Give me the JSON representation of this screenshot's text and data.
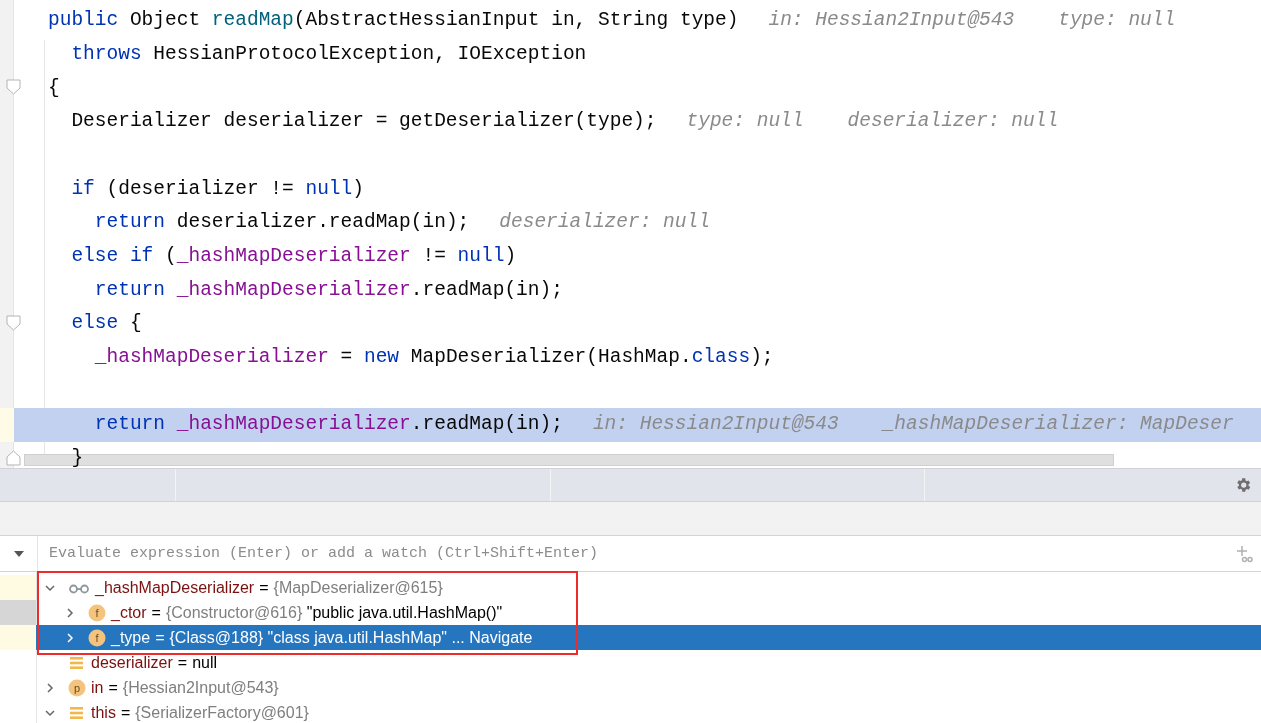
{
  "editor": {
    "lines": [
      {
        "kind": "code",
        "tokens": [
          {
            "text": "public",
            "kind": "keyword"
          },
          {
            "text": " Object ",
            "kind": "plain"
          },
          {
            "text": "readMap",
            "kind": "method"
          },
          {
            "text": "(AbstractHessianInput in, String type)",
            "kind": "plain"
          }
        ],
        "hints": [
          "in: Hessian2Input@543",
          "type: null"
        ],
        "selected": false
      },
      {
        "kind": "code",
        "tokens": [
          {
            "text": "  throws",
            "kind": "keyword"
          },
          {
            "text": " HessianProtocolException, IOException",
            "kind": "plain"
          }
        ],
        "selected": false
      },
      {
        "kind": "fold-start",
        "tokens": [
          {
            "text": "{",
            "kind": "plain"
          }
        ],
        "selected": false
      },
      {
        "kind": "code",
        "tokens": [
          {
            "text": "  Deserializer deserializer = getDeserializer(type);",
            "kind": "plain"
          }
        ],
        "hints": [
          "type: null",
          "deserializer: null"
        ],
        "selected": false
      },
      {
        "kind": "code",
        "selected": false
      },
      {
        "kind": "code",
        "tokens": [
          {
            "text": "  if",
            "kind": "keyword"
          },
          {
            "text": " (deserializer != ",
            "kind": "plain"
          },
          {
            "text": "null",
            "kind": "keyword"
          },
          {
            "text": ")",
            "kind": "plain"
          }
        ],
        "selected": false
      },
      {
        "kind": "code",
        "tokens": [
          {
            "text": "    return",
            "kind": "keyword"
          },
          {
            "text": " deserializer.readMap(in);",
            "kind": "plain"
          }
        ],
        "hints": [
          "deserializer: null"
        ],
        "selected": false
      },
      {
        "kind": "code",
        "tokens": [
          {
            "text": "  else if",
            "kind": "keyword"
          },
          {
            "text": " (",
            "kind": "plain"
          },
          {
            "text": "_hashMapDeserializer",
            "kind": "field"
          },
          {
            "text": " != ",
            "kind": "plain"
          },
          {
            "text": "null",
            "kind": "keyword"
          },
          {
            "text": ")",
            "kind": "plain"
          }
        ],
        "selected": false
      },
      {
        "kind": "code",
        "tokens": [
          {
            "text": "    return",
            "kind": "keyword"
          },
          {
            "text": " _hashMapDeserializer",
            "kind": "field"
          },
          {
            "text": ".readMap(in);",
            "kind": "plain"
          }
        ],
        "selected": false
      },
      {
        "kind": "fold-start",
        "tokens": [
          {
            "text": "  else",
            "kind": "keyword"
          },
          {
            "text": " {",
            "kind": "plain"
          }
        ],
        "selected": false
      },
      {
        "kind": "code",
        "tokens": [
          {
            "text": "    _hashMapDeserializer",
            "kind": "field"
          },
          {
            "text": " = ",
            "kind": "plain"
          },
          {
            "text": "new",
            "kind": "keyword"
          },
          {
            "text": " MapDeserializer(HashMap.",
            "kind": "plain"
          },
          {
            "text": "class",
            "kind": "keyword"
          },
          {
            "text": ");",
            "kind": "plain"
          }
        ],
        "selected": false
      },
      {
        "kind": "code",
        "selected": false
      },
      {
        "kind": "code",
        "tokens": [
          {
            "text": "    return",
            "kind": "keyword"
          },
          {
            "text": " _hashMapDeserializer",
            "kind": "field"
          },
          {
            "text": ".readMap(in);",
            "kind": "plain"
          }
        ],
        "hints": [
          "in: Hessian2Input@543",
          "_hashMapDeserializer: MapDeser"
        ],
        "selected": true
      },
      {
        "kind": "fold-end",
        "tokens": [
          {
            "text": "  }",
            "kind": "plain"
          }
        ],
        "selected": false
      }
    ]
  },
  "watch": {
    "placeholder": "Evaluate expression (Enter) or add a watch (Ctrl+Shift+Enter)"
  },
  "variables": [
    {
      "kind": "watch",
      "name": "_hashMapDeserializer",
      "equals": "=",
      "ref": "{MapDeserializer@615}",
      "expanded": true,
      "selected": false,
      "color": "#fffbe3",
      "children": [
        {
          "kind": "field",
          "badge": "f",
          "name": "_ctor",
          "equals": "=",
          "ref": "{Constructor@616}",
          "text": "\"public java.util.HashMap()\"",
          "expanded": false,
          "selected": false,
          "color": "#d6d6d6"
        },
        {
          "kind": "field",
          "badge": "f",
          "name": "_type",
          "equals": "=",
          "ref": "{Class@188}",
          "text": "\"class java.util.HashMap\"",
          "link": "... Navigate",
          "expanded": false,
          "selected": true,
          "color": "#fffbe3"
        }
      ]
    },
    {
      "kind": "local",
      "name": "deserializer",
      "equals": "=",
      "text": "null",
      "selected": false
    },
    {
      "kind": "param",
      "badge": "p",
      "name": "in",
      "equals": "=",
      "ref": "{Hessian2Input@543}",
      "expanded": false,
      "selected": false
    },
    {
      "kind": "local",
      "name": "this",
      "equals": "=",
      "ref": "{SerializerFactory@601}",
      "expanded": true,
      "selected": false
    }
  ]
}
